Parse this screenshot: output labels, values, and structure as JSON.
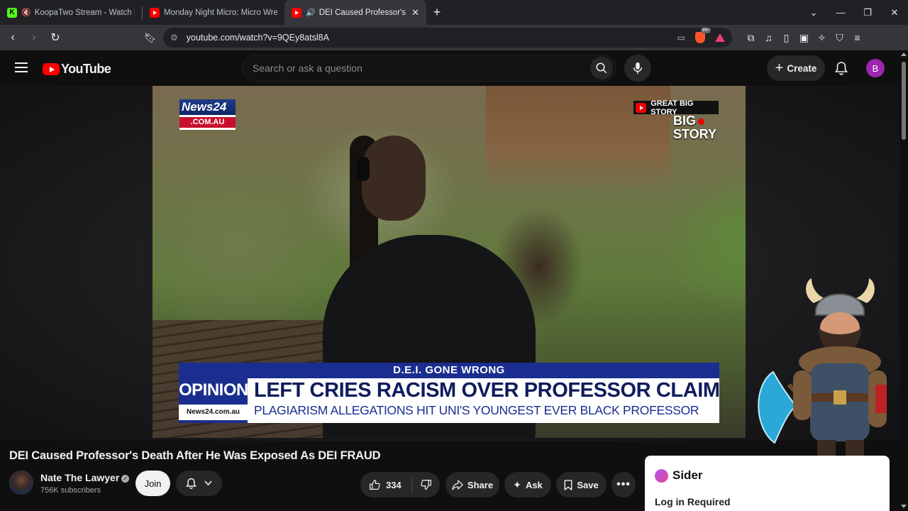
{
  "browser": {
    "tabs": [
      {
        "title": "KoopaTwo Stream - Watch Live o",
        "icon": "kick-logo-icon",
        "muted": true,
        "active": false
      },
      {
        "title": "Monday Night Micro: Micro Wrestlin",
        "icon": "youtube-logo-icon",
        "muted": false,
        "active": false
      },
      {
        "title": "DEI Caused Professor's Death",
        "icon": "youtube-logo-icon",
        "muted": false,
        "playing_audio": true,
        "active": true
      }
    ],
    "url": "youtube.com/watch?v=9QEy8atsl8A",
    "brave_badge": "99+"
  },
  "youtube": {
    "logo_text": "YouTube",
    "search_placeholder": "Search or ask a question",
    "create_label": "Create",
    "account_initial": "B",
    "account_color": "#9c27b0"
  },
  "video": {
    "overlay": {
      "news_logo_top": "News",
      "news_logo_num": "24",
      "news_logo_bottom": ".COM.AU",
      "badge": "GREAT BIG STORY",
      "corner_line1": "BIG",
      "corner_line2": "STORY",
      "tag": "D.E.I. GONE WRONG",
      "opinion": "OPINION",
      "site": "News24.com.au",
      "headline": "LEFT CRIES RACISM OVER PROFESSOR CLAIM",
      "subhead": "PLAGIARISM ALLEGATIONS HIT UNI'S YOUNGEST EVER BLACK PROFESSOR"
    },
    "title": "DEI Caused Professor's Death After He Was Exposed As DEI FRAUD",
    "channel": {
      "name": "Nate The Lawyer",
      "subscribers": "756K subscribers",
      "verified": true
    },
    "actions": {
      "join": "Join",
      "likes": "334",
      "share": "Share",
      "ask": "Ask",
      "save": "Save"
    }
  },
  "sider": {
    "name": "Sider",
    "login_text": "Log in Required"
  },
  "colors": {
    "youtube_red": "#ff0000",
    "background": "#0f0f0f",
    "news24_blue": "#1a2e8f"
  }
}
